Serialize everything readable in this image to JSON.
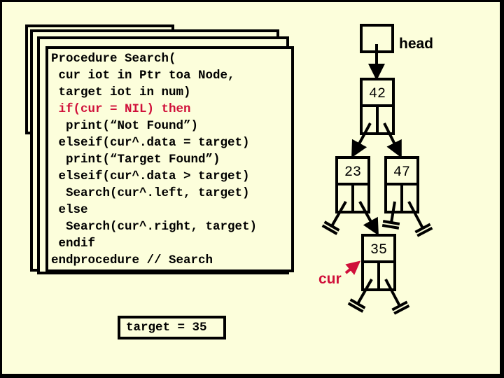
{
  "slide": {
    "background_color": "#fcfedb",
    "border_color": "#000000"
  },
  "code_panel": {
    "title_line": "Procedure Search(",
    "lines": [
      {
        "text": "Procedure Search(",
        "highlight": false
      },
      {
        "text": " cur iot in Ptr toa Node,",
        "highlight": false
      },
      {
        "text": " target iot in num)",
        "highlight": false
      },
      {
        "text": " if(cur = NIL) then",
        "highlight": true
      },
      {
        "text": "  print(“Not Found”)",
        "highlight": false
      },
      {
        "text": " elseif(cur^.data = target)",
        "highlight": false
      },
      {
        "text": "  print(“Target Found”)",
        "highlight": false
      },
      {
        "text": " elseif(cur^.data > target)",
        "highlight": false
      },
      {
        "text": "  Search(cur^.left, target)",
        "highlight": false
      },
      {
        "text": " else",
        "highlight": false
      },
      {
        "text": "  Search(cur^.right, target)",
        "highlight": false
      },
      {
        "text": " endif",
        "highlight": false
      },
      {
        "text": "endprocedure // Search",
        "highlight": false
      }
    ],
    "highlight_color": "#d0103a",
    "stacked_recursive_frames": 4
  },
  "target_box": {
    "text": "target = 35"
  },
  "tree": {
    "head_label": "head",
    "cur_label": "cur",
    "cur_color": "#d0103a",
    "nodes": [
      {
        "id": "n42",
        "value": "42",
        "left": "n23",
        "right": "n47"
      },
      {
        "id": "n23",
        "value": "23",
        "left": null,
        "right": "n35"
      },
      {
        "id": "n47",
        "value": "47",
        "left": null,
        "right": null
      },
      {
        "id": "n35",
        "value": "35",
        "left": null,
        "right": null
      }
    ],
    "head_points_to": "n42",
    "cur_points_to": "n35"
  }
}
